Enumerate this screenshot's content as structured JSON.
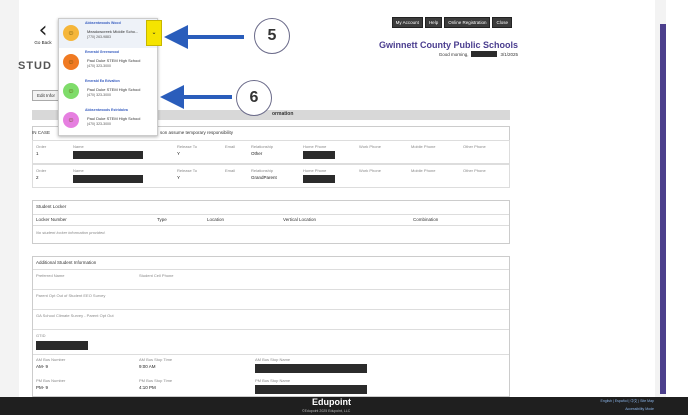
{
  "back": {
    "label": "Go Back",
    "icon": "chevron-left-icon"
  },
  "top_buttons": [
    "My Account",
    "Help",
    "Online Registration",
    "Close"
  ],
  "school_name": "Gwinnett County Public Schools",
  "greeting": "Good morning,",
  "date": "3/1/2025",
  "page_title": "STUD",
  "edit_button": "Edit Infor",
  "section_title": "ormation",
  "emergency": {
    "in_case": "IN CASE",
    "note": "son assume temporary responsibility",
    "headers": [
      "Order",
      "Name",
      "Release To",
      "Email",
      "Relationship",
      "Home Phone",
      "Work Phone",
      "Mobile Phone",
      "Other Phone"
    ],
    "rows": [
      {
        "order": "1",
        "release": "Y",
        "relationship": "Other"
      },
      {
        "order": "2",
        "release": "Y",
        "relationship": "GrandParent"
      }
    ]
  },
  "locker": {
    "title": "Student Locker",
    "headers": [
      "Locker Number",
      "Type",
      "Location",
      "Vertical Location",
      "Combination"
    ],
    "empty": "No student locker information provided."
  },
  "additional": {
    "title": "Additional Student Information",
    "fields": [
      "Preferred Name",
      "Student Cell Phone"
    ],
    "eec": "Parent Opt Out of Student EEO Survey",
    "ga_survey": "GA School Climate Survey - Parent Opt Out",
    "gtid": "GTID"
  },
  "bus": {
    "am_label": "AM Bus Number",
    "am_value": "AM- 9",
    "am_time_label": "AM Bus Stop Time",
    "am_time": "9:00 AM",
    "am_stop_label": "AM Bus Stop Name",
    "pm_label": "PM Bus Number",
    "pm_value": "PM- 9",
    "pm_time_label": "PM Bus Stop Time",
    "pm_time": "4:10 PM",
    "pm_stop_label": "PM Bus Stop Name"
  },
  "dropdown": [
    {
      "name": "Abbsentwoods Wood",
      "school": "Meadowcreek Middle Scho...",
      "phone": "(770) 263-9883",
      "color": "#f5b63a"
    },
    {
      "name": "Emerald Greenwood",
      "school": "Paul Duke STEM High School",
      "phone": "(470) 323-3000",
      "color": "#f07a22"
    },
    {
      "name": "Emerald Ea Edvalton",
      "school": "Paul Duke STEM High School",
      "phone": "(470) 323-3000",
      "color": "#7fdc6a"
    },
    {
      "name": "Abbsentwoods Estridalva",
      "school": "Paul Duke STEM High School",
      "phone": "(470) 323-3000",
      "color": "#e67fe0"
    }
  ],
  "callouts": [
    "5",
    "6"
  ],
  "footer": {
    "logo": "Edupoint",
    "copyright": "©Edupoint 2025 Edupoint, LLC",
    "links": "English | Español | 中文 | Site Map",
    "links2": "Accessibility Mode"
  }
}
